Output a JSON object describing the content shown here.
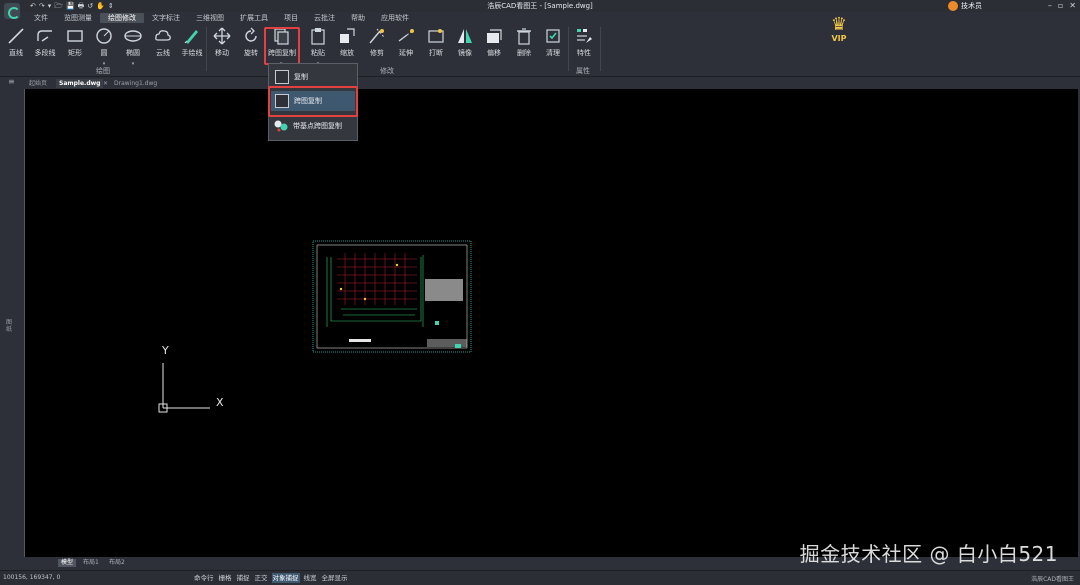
{
  "titlebar": {
    "quick_access": [
      "↶",
      "↷",
      "▾",
      "🗁",
      "💾",
      "🖶",
      "↺",
      "✋",
      "⇕"
    ],
    "window_title": "浩辰CAD看图王 - [Sample.dwg]",
    "user_name": "技术员",
    "window_controls": [
      "–",
      "▫",
      "✕"
    ]
  },
  "menu": [
    "文件",
    "览图测量",
    "绘图修改",
    "文字标注",
    "三维视图",
    "扩展工具",
    "项目",
    "云批注",
    "帮助",
    "应用软件"
  ],
  "menu_active_index": 2,
  "ribbon": {
    "tools": [
      "直线",
      "多段线",
      "矩形",
      "圆",
      "椭圆",
      "云线",
      "手绘线",
      "移动",
      "旋转",
      "跨图复制",
      "粘贴",
      "缩放",
      "修剪",
      "延伸",
      "打断",
      "镜像",
      "偏移",
      "删除",
      "清理",
      "特性"
    ],
    "groups": {
      "draw": "绘图",
      "modify": "修改",
      "props": "属性"
    },
    "vip": "VIP"
  },
  "doc_tabs": [
    "起始页",
    "Sample.dwg",
    "Drawing1.dwg"
  ],
  "doc_tab_close": "✕",
  "left_rail_label": "图纸",
  "dropdown": {
    "items": [
      "复制",
      "跨图复制",
      "带基点跨图复制"
    ]
  },
  "axes": {
    "y": "Y",
    "x": "X"
  },
  "layout_tabs": [
    "模型",
    "布局1",
    "布局2"
  ],
  "status": {
    "coords": "100156, 169347, 0",
    "tools": [
      "命令行",
      "栅格",
      "捕捉",
      "正交",
      "对象捕捉",
      "线宽",
      "全屏显示"
    ],
    "app": "浩辰CAD看图王"
  },
  "watermark": "掘金技术社区 @ 白小白521",
  "colors": {
    "highlight": "#e34141",
    "canvas": "#000000",
    "accent": "#43d3b0",
    "crown": "#f3c545"
  }
}
